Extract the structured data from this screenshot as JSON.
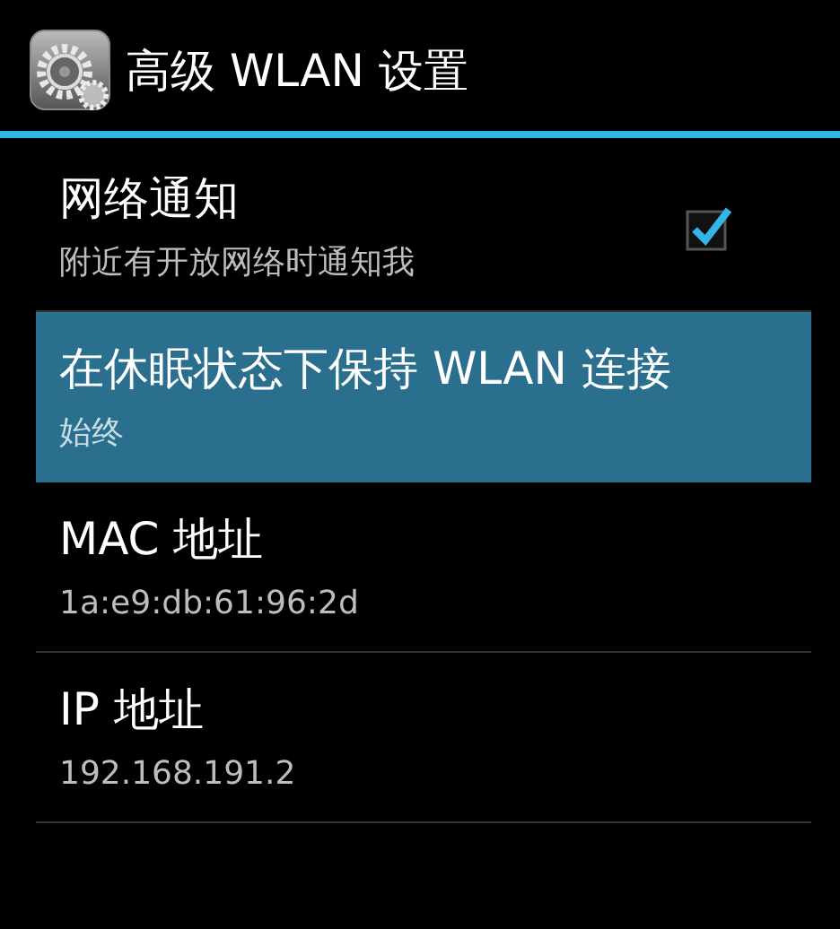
{
  "action_bar": {
    "title": "高级 WLAN 设置"
  },
  "preferences": [
    {
      "kind": "checkbox",
      "title": "网络通知",
      "summary": "附近有开放网络时通知我",
      "checked": true,
      "selected": false
    },
    {
      "kind": "plain",
      "title": "在休眠状态下保持 WLAN 连接",
      "summary": "始终",
      "selected": true
    },
    {
      "kind": "plain",
      "title": "MAC 地址",
      "summary": "1a:e9:db:61:96:2d",
      "selected": false
    },
    {
      "kind": "plain",
      "title": "IP 地址",
      "summary": "192.168.191.2",
      "selected": false
    }
  ]
}
